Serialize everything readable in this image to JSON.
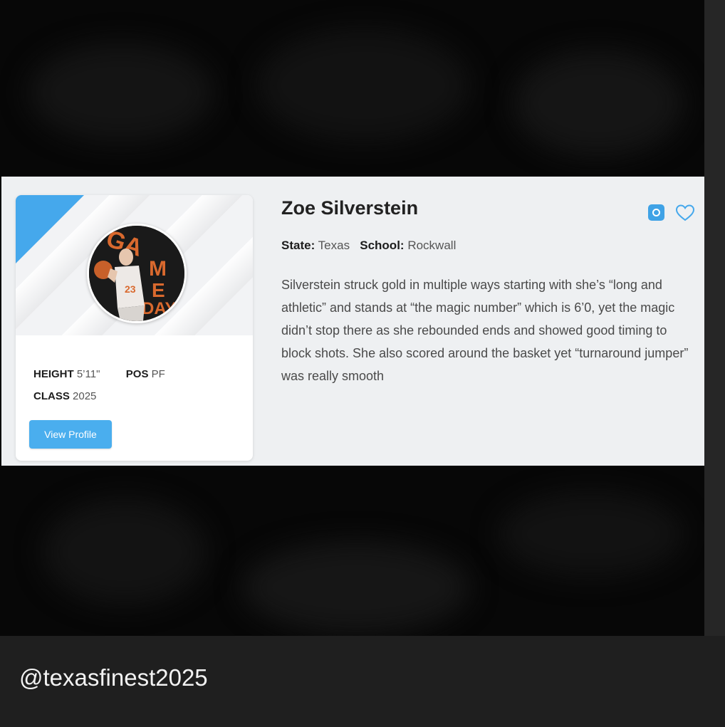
{
  "player": {
    "name": "Zoe Silverstein",
    "state_label": "State:",
    "state": "Texas",
    "school_label": "School:",
    "school": "Rockwall",
    "bio": "Silverstein struck gold in multiple ways starting with she’s “long and athletic” and stands at “the magic number” which is 6’0, yet the magic didn’t stop there as she rebounded ends and showed good timing to block shots. She also scored around the basket yet “turnaround jumper” was really smooth",
    "height_label": "HEIGHT",
    "height": "5’11\"",
    "pos_label": "POS",
    "pos": "PF",
    "class_label": "CLASS",
    "class": "2025",
    "view_profile": "View Profile",
    "avatar_text": "GAME DAY"
  },
  "icons": {
    "social": "instagram-icon",
    "favorite": "heart-outline-icon"
  },
  "caption": {
    "handle": "@texasfinest2025"
  },
  "colors": {
    "accent": "#45a8ec",
    "band": "#eef0f2",
    "background": "#070707",
    "caption_bg": "#1f1f1f"
  }
}
